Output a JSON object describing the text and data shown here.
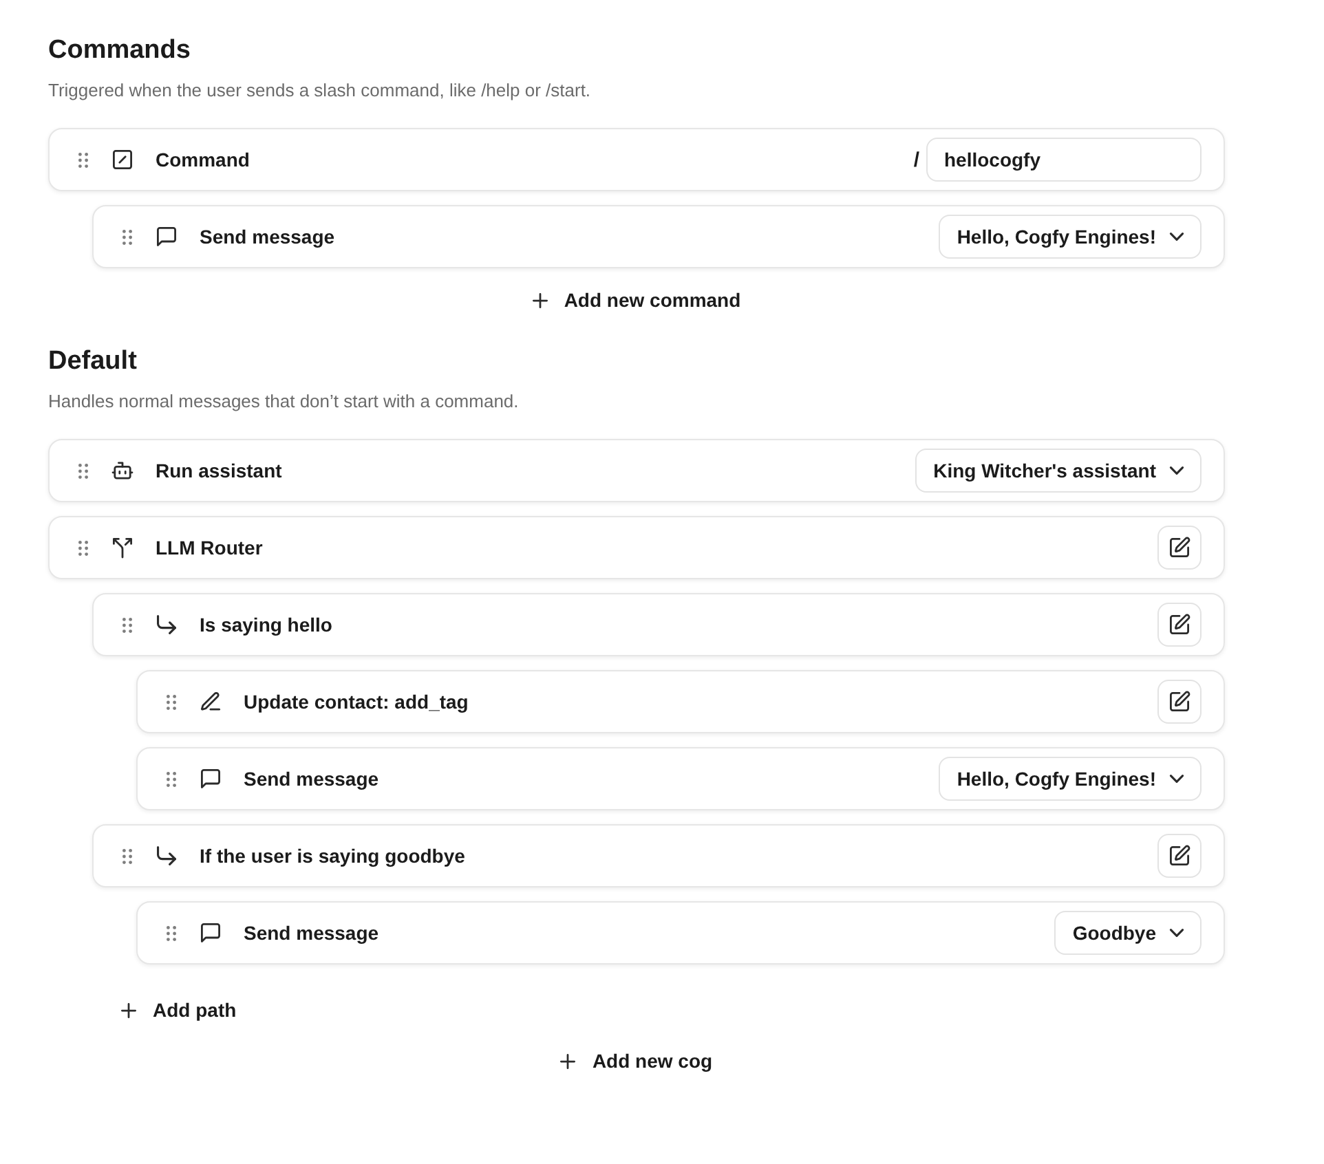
{
  "sections": [
    {
      "title": "Commands",
      "description": "Triggered when the user sends a slash command, like /help or /start.",
      "steps": [
        {
          "kind": "command",
          "label": "Command",
          "control": {
            "kind": "text_input",
            "prefix": "/",
            "value": "hellocogfy"
          },
          "children": [
            {
              "kind": "send_message",
              "label": "Send message",
              "control": {
                "kind": "select",
                "value": "Hello, Cogfy Engines!"
              }
            }
          ]
        }
      ],
      "add_button": "Add new command"
    },
    {
      "title": "Default",
      "description": "Handles normal messages that don’t start with a command.",
      "steps": [
        {
          "kind": "run_assistant",
          "label": "Run assistant",
          "control": {
            "kind": "select",
            "value": "King Witcher's assistant"
          }
        },
        {
          "kind": "llm_router",
          "label": "LLM Router",
          "control": {
            "kind": "edit"
          },
          "children": [
            {
              "kind": "path",
              "label": "Is saying hello",
              "control": {
                "kind": "edit"
              },
              "children": [
                {
                  "kind": "update_contact",
                  "label": "Update contact: add_tag",
                  "control": {
                    "kind": "edit"
                  }
                },
                {
                  "kind": "send_message",
                  "label": "Send message",
                  "control": {
                    "kind": "select",
                    "value": "Hello, Cogfy Engines!"
                  }
                }
              ]
            },
            {
              "kind": "path",
              "label": "If the user is saying goodbye",
              "control": {
                "kind": "edit"
              },
              "children": [
                {
                  "kind": "send_message",
                  "label": "Send message",
                  "control": {
                    "kind": "select",
                    "value": "Goodbye"
                  }
                }
              ]
            }
          ],
          "add_button": "Add path"
        }
      ],
      "add_button": "Add new cog"
    }
  ]
}
